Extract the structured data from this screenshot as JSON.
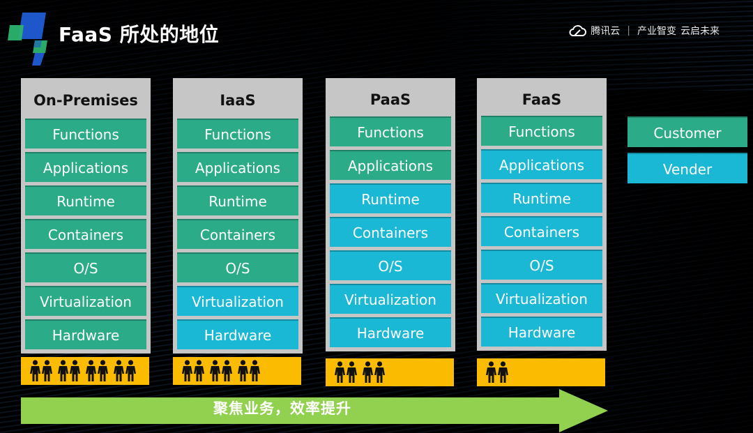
{
  "header": {
    "title": "FaaS 所处的地位",
    "brand": {
      "name": "腾讯云",
      "slogan_1": "产业智变",
      "slogan_2": "云启未来",
      "icon": "tencent-cloud-logo-icon"
    }
  },
  "colors": {
    "customer": "#2bab88",
    "vendor": "#1bb8d6",
    "column_bg": "#c6c6c6",
    "people_bar": "#fbbb00",
    "arrow": "#92d050"
  },
  "columns": [
    {
      "title": "On-Premises",
      "people_count": 8,
      "layers": [
        {
          "label": "Functions",
          "owner": "customer"
        },
        {
          "label": "Applications",
          "owner": "customer"
        },
        {
          "label": "Runtime",
          "owner": "customer"
        },
        {
          "label": "Containers",
          "owner": "customer"
        },
        {
          "label": "O/S",
          "owner": "customer"
        },
        {
          "label": "Virtualization",
          "owner": "customer"
        },
        {
          "label": "Hardware",
          "owner": "customer"
        }
      ]
    },
    {
      "title": "IaaS",
      "people_count": 6,
      "layers": [
        {
          "label": "Functions",
          "owner": "customer"
        },
        {
          "label": "Applications",
          "owner": "customer"
        },
        {
          "label": "Runtime",
          "owner": "customer"
        },
        {
          "label": "Containers",
          "owner": "customer"
        },
        {
          "label": "O/S",
          "owner": "customer"
        },
        {
          "label": "Virtualization",
          "owner": "vendor"
        },
        {
          "label": "Hardware",
          "owner": "vendor"
        }
      ]
    },
    {
      "title": "PaaS",
      "people_count": 4,
      "layers": [
        {
          "label": "Functions",
          "owner": "customer"
        },
        {
          "label": "Applications",
          "owner": "customer"
        },
        {
          "label": "Runtime",
          "owner": "vendor"
        },
        {
          "label": "Containers",
          "owner": "vendor"
        },
        {
          "label": "O/S",
          "owner": "vendor"
        },
        {
          "label": "Virtualization",
          "owner": "vendor"
        },
        {
          "label": "Hardware",
          "owner": "vendor"
        }
      ]
    },
    {
      "title": "FaaS",
      "people_count": 2,
      "layers": [
        {
          "label": "Functions",
          "owner": "customer"
        },
        {
          "label": "Applications",
          "owner": "vendor"
        },
        {
          "label": "Runtime",
          "owner": "vendor"
        },
        {
          "label": "Containers",
          "owner": "vendor"
        },
        {
          "label": "O/S",
          "owner": "vendor"
        },
        {
          "label": "Virtualization",
          "owner": "vendor"
        },
        {
          "label": "Hardware",
          "owner": "vendor"
        }
      ]
    }
  ],
  "legend": {
    "customer": "Customer",
    "vendor": "Vender"
  },
  "arrow": {
    "label": "聚焦业务，效率提升"
  }
}
